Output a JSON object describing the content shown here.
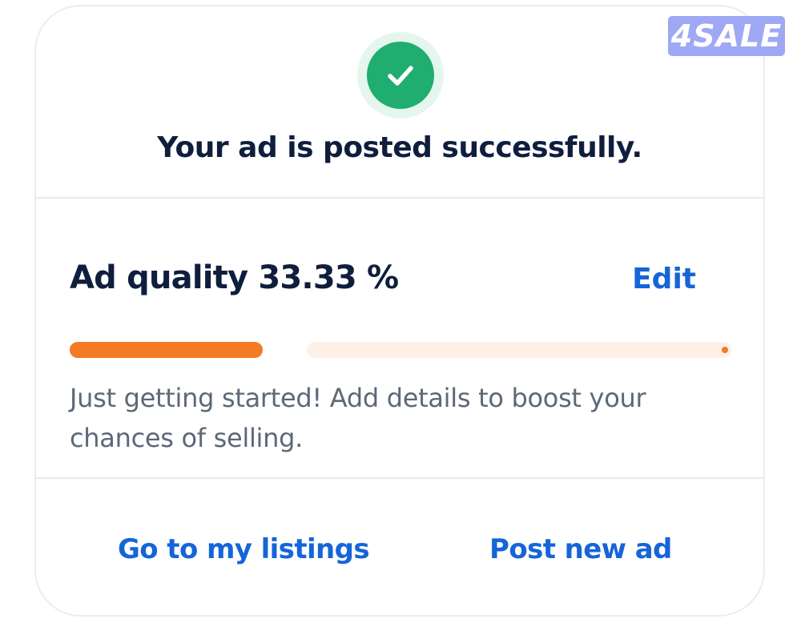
{
  "watermark": {
    "brand": "4SALE"
  },
  "success": {
    "title": "Your ad is posted successfully.",
    "icon": "check-circle-icon",
    "accent_color": "#1fae6f"
  },
  "quality": {
    "title": "Ad quality 33.33 %",
    "percent": 33.33,
    "edit_label": "Edit",
    "hint": "Just getting started! Add details to boost your chances of selling.",
    "bar_color": "#f47a24",
    "track_color": "#fdf0e7"
  },
  "actions": {
    "my_listings_label": "Go to my listings",
    "post_new_label": "Post new ad",
    "link_color": "#1565d8"
  }
}
